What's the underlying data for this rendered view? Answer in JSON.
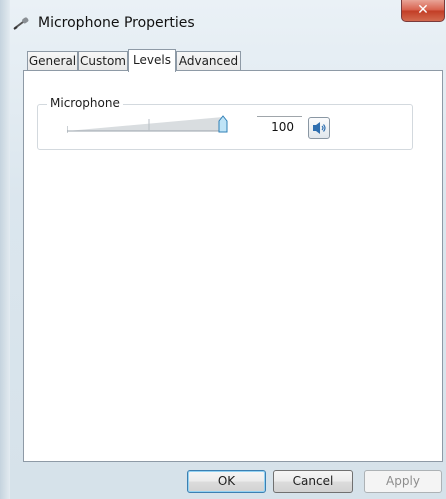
{
  "window": {
    "title": "Microphone Properties",
    "close_label": "✕",
    "icon": "microphone-icon"
  },
  "tabs": [
    {
      "label": "General",
      "active": false
    },
    {
      "label": "Custom",
      "active": false
    },
    {
      "label": "Levels",
      "active": true
    },
    {
      "label": "Advanced",
      "active": false
    }
  ],
  "levels": {
    "group_label": "Microphone",
    "slider_level": 1.0,
    "value": "100",
    "speaker_icon": "speaker-icon"
  },
  "buttons": {
    "ok": "OK",
    "cancel": "Cancel",
    "apply": "Apply"
  },
  "colors": {
    "accent": "#3c7fb1",
    "close": "#c23d25"
  }
}
